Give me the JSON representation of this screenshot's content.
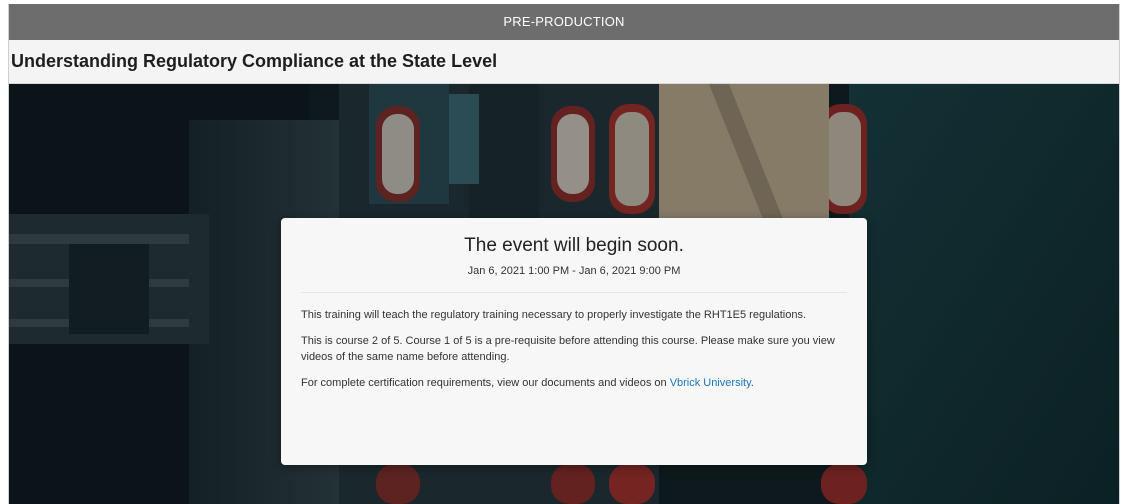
{
  "status_bar": {
    "label": "PRE-PRODUCTION"
  },
  "event": {
    "title": "Understanding Regulatory Compliance at the State Level",
    "heading": "The event will begin soon.",
    "schedule": "Jan 6, 2021 1:00 PM - Jan 6, 2021 9:00 PM",
    "paragraph_1": "This training will teach the regulatory training necessary to properly investigate the RHT1E5 regulations.",
    "paragraph_2": "This is course 2 of 5.  Course 1 of 5 is a pre-requisite before attending this course. Please make sure you view videos of the same name before attending.",
    "paragraph_3_prefix": "For complete certification requirements, view our documents and videos on ",
    "paragraph_3_link": "Vbrick University",
    "paragraph_3_suffix": "."
  },
  "colors": {
    "status_bar_bg": "#6d6d6d",
    "link": "#1a76b8",
    "water": "#123036"
  }
}
